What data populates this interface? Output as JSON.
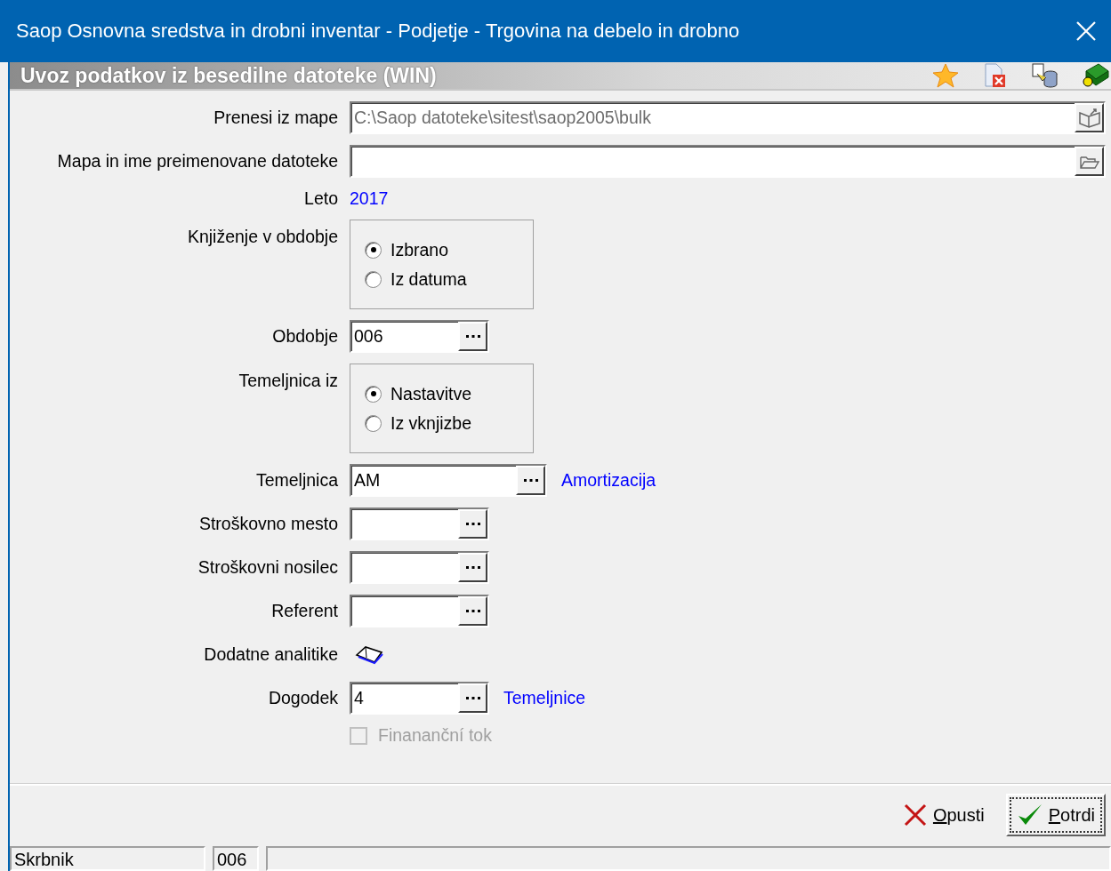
{
  "window": {
    "title": "Saop Osnovna sredstva in drobni inventar  - Podjetje - Trgovina na debelo in drobno"
  },
  "header": {
    "title": "Uvoz podatkov iz besedilne datoteke (WIN)"
  },
  "fields": [
    {
      "kind": "folder_path",
      "label": "Prenesi iz mape",
      "value": "C:\\Saop datoteke\\sitest\\saop2005\\bulk",
      "disabled": true
    },
    {
      "kind": "file_path",
      "label": "Mapa in ime preimenovane datoteke"
    },
    {
      "kind": "value",
      "label": "Leto",
      "value": "2017"
    },
    {
      "kind": "radio",
      "label": "Knjiženje v obdobje",
      "options": [
        {
          "label": "Izbrano",
          "selected": true
        },
        {
          "label": "Iz datuma",
          "selected": false
        }
      ]
    },
    {
      "kind": "lookup",
      "label": "Obdobje",
      "value": "006",
      "wide": false
    },
    {
      "kind": "radio",
      "label": "Temeljnica iz",
      "options": [
        {
          "label": "Nastavitve",
          "selected": true
        },
        {
          "label": "Iz vknjizbe",
          "selected": false
        }
      ]
    },
    {
      "kind": "lookup",
      "label": "Temeljnica",
      "value": "AM",
      "wide": true,
      "link": "Amortizacija"
    },
    {
      "kind": "lookup",
      "label": "Stroškovno mesto",
      "wide": false
    },
    {
      "kind": "lookup",
      "label": "Stroškovni nosilec",
      "wide": false
    },
    {
      "kind": "lookup",
      "label": "Referent",
      "wide": false
    },
    {
      "kind": "icon",
      "label": "Dodatne analitike"
    },
    {
      "kind": "lookup",
      "label": "Dogodek",
      "value": "4",
      "wide": false,
      "link": "Temeljnice"
    },
    {
      "kind": "checkbox",
      "label": "Finananční tok",
      "checked": false,
      "disabled": true
    }
  ],
  "buttons": [
    {
      "kind": "cancel",
      "label": "Opusti",
      "focused": false
    },
    {
      "kind": "ok",
      "label": "Potrdi",
      "focused": true
    }
  ],
  "status_bar": {
    "cells": [
      "Skrbnik",
      "006"
    ]
  }
}
